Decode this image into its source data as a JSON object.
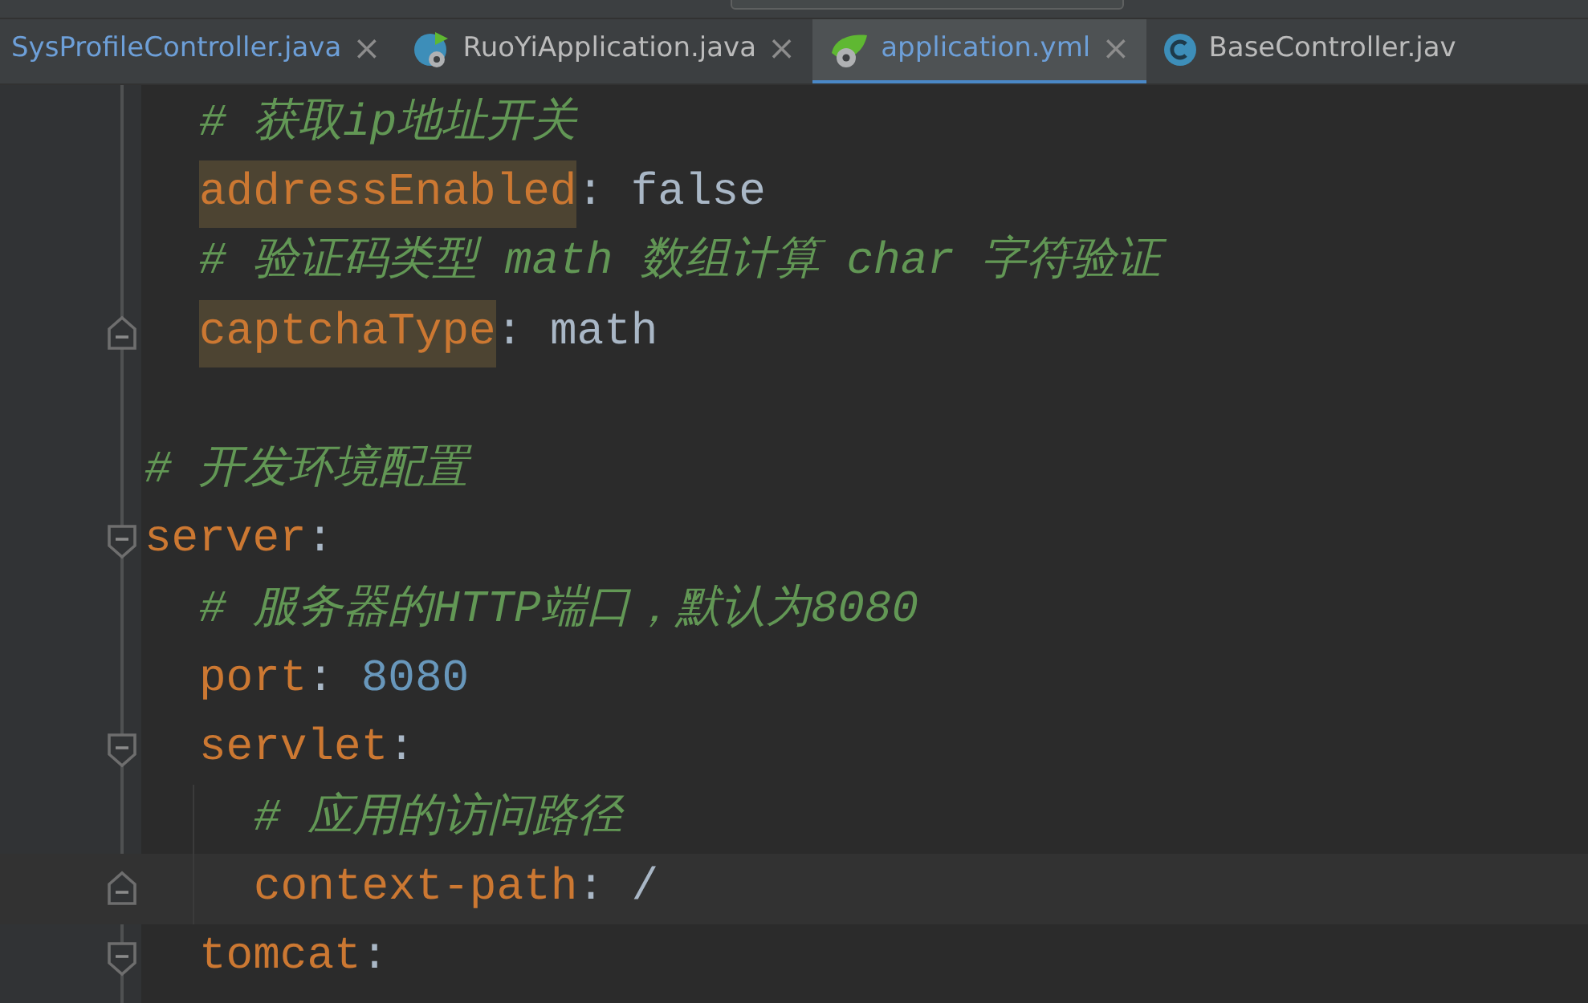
{
  "tabs": [
    {
      "label": "SysProfileController.java",
      "kind": "plain",
      "modified": true,
      "selected": false,
      "close": "×"
    },
    {
      "label": "RuoYiApplication.java",
      "kind": "application",
      "modified": false,
      "selected": false,
      "close": "×"
    },
    {
      "label": "application.yml",
      "kind": "config",
      "modified": true,
      "selected": true,
      "close": "×"
    },
    {
      "label": "BaseController.jav",
      "kind": "class",
      "modified": false,
      "selected": false
    }
  ],
  "editor": {
    "continued_block": [
      {
        "kind": "comment",
        "text": "# 获取ip地址开关"
      },
      {
        "kind": "entry",
        "key": "addressEnabled",
        "sep": ":",
        "value": {
          "text": "false",
          "kind": "plain"
        },
        "highlighted": true
      },
      {
        "kind": "comment",
        "text": "# 验证码类型 math 数组计算 char 字符验证"
      },
      {
        "kind": "entry",
        "key": "captchaType",
        "sep": ":",
        "value": {
          "text": "math",
          "kind": "plain"
        },
        "highlighted": true,
        "fold": {
          "kind": "end"
        }
      }
    ],
    "lines": [
      {
        "kind": "blank"
      },
      {
        "kind": "comment",
        "text": "# 开发环境配置"
      },
      {
        "kind": "entry",
        "key": "server",
        "sep": ":",
        "fold": {
          "kind": "start"
        },
        "children": [
          {
            "kind": "comment",
            "text": "# 服务器的HTTP端口，默认为8080"
          },
          {
            "kind": "entry",
            "key": "port",
            "sep": ":",
            "value": {
              "text": "8080",
              "kind": "number"
            }
          },
          {
            "kind": "entry",
            "key": "servlet",
            "sep": ":",
            "fold": {
              "kind": "start"
            },
            "children": [
              {
                "kind": "comment",
                "text": "# 应用的访问路径"
              },
              {
                "kind": "entry",
                "key": "context-path",
                "sep": ":",
                "value": {
                  "text": "/",
                  "kind": "plain"
                },
                "current": true,
                "fold": {
                  "kind": "end"
                }
              }
            ]
          },
          {
            "kind": "entry",
            "key": "tomcat",
            "sep": ":",
            "fold": {
              "kind": "start"
            }
          }
        ]
      }
    ]
  }
}
